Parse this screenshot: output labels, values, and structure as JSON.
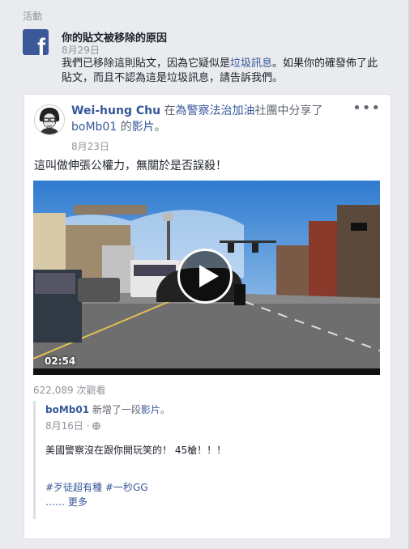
{
  "section": {
    "title": "活動"
  },
  "notice": {
    "title": "你的貼文被移除的原因",
    "date": "8月29日",
    "body_before": "我們已移除這則貼文，因為它疑似是",
    "body_link": "垃圾訊息",
    "body_after": "。如果你的確發佈了此貼文，而且不認為這是垃圾訊息，請告訴我們。"
  },
  "post": {
    "author": "Wei-hung Chu",
    "in_text": " 在",
    "group": "為警察法治加油",
    "shared_text": "社團中分享了",
    "source_name": "boMb01",
    "of_text": " 的",
    "video_word": "影片",
    "period": "。",
    "date": "8月23日",
    "more_icon": "•••",
    "text": "這叫做伸張公權力，無關於是否誤殺！",
    "video": {
      "duration": "02:54"
    },
    "views": "622,089 次觀看"
  },
  "shared_post": {
    "author": "boMb01",
    "action": " 新增了一段",
    "video_word": "影片",
    "period": "。",
    "date": "8月16日",
    "privacy_separator": "·",
    "text": "美國警察沒在跟你開玩笑的！ 45槍！！！",
    "hashtag1": "#歹徒超有種",
    "hashtag2": "#一秒GG",
    "more": "…… 更多"
  }
}
